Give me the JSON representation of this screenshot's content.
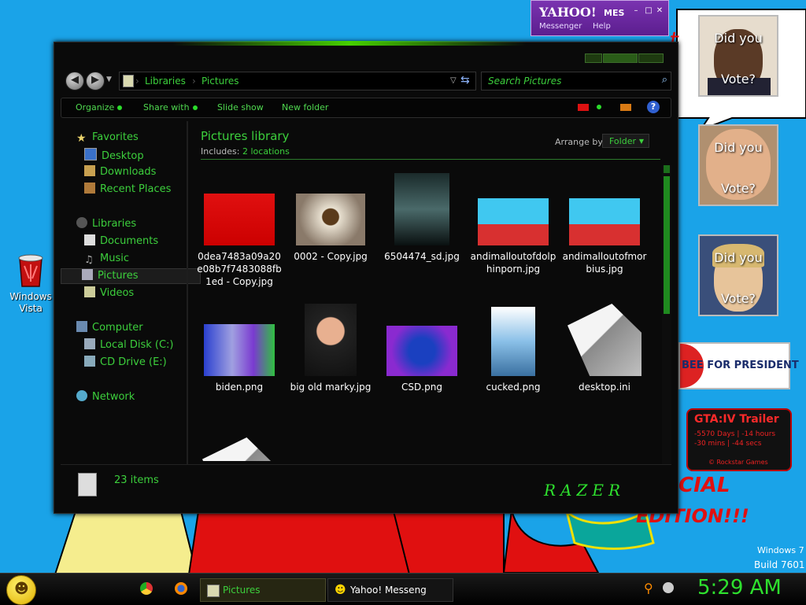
{
  "desktop": {
    "recycle_label": "Windows Vista",
    "watermark_line1": "Windows 7",
    "watermark_line2": "Build 7601",
    "bg_text1": "CIAL",
    "bg_text2": "EDITION!!!",
    "huckabee_text": "BEE FOR PRESIDENT",
    "vote_line1": "Did you",
    "vote_line2": "Vote?"
  },
  "yahoo": {
    "logo": "YAHOO!",
    "title_rest": "MES",
    "menu_messenger": "Messenger",
    "menu_help": "Help"
  },
  "gta": {
    "title": "GTA:IV Trailer",
    "line1": "-5570 Days | -14 hours",
    "line2": "-30 mins | -44 secs",
    "footer": "© Rockstar Games"
  },
  "window": {
    "breadcrumb": [
      "Libraries",
      "Pictures"
    ],
    "search_placeholder": "Search Pictures",
    "toolbar": {
      "organize": "Organize",
      "share_with": "Share with",
      "slide_show": "Slide show",
      "new_folder": "New folder"
    },
    "sidebar": {
      "favorites": "Favorites",
      "desktop": "Desktop",
      "downloads": "Downloads",
      "recent_places": "Recent Places",
      "libraries": "Libraries",
      "documents": "Documents",
      "music": "Music",
      "pictures": "Pictures",
      "videos": "Videos",
      "computer": "Computer",
      "local_disk": "Local Disk (C:)",
      "cd_drive": "CD Drive (E:)",
      "network": "Network"
    },
    "library": {
      "title": "Pictures library",
      "includes_label": "Includes:",
      "includes_link": "2 locations",
      "arrange_label": "Arrange by:",
      "arrange_value": "Folder"
    },
    "files": [
      {
        "name": "0dea7483a09a20e08b7f7483088fb1ed - Copy.jpg",
        "kind": "img-red"
      },
      {
        "name": "0002 - Copy.jpg",
        "kind": "img-toilet"
      },
      {
        "name": "6504474_sd.jpg",
        "kind": "img-poster"
      },
      {
        "name": "andimalloutofdolphinporn.jpg",
        "kind": "img-comic"
      },
      {
        "name": "andimalloutofmorbius.jpg",
        "kind": "img-comic"
      },
      {
        "name": "biden.png",
        "kind": "img-biden"
      },
      {
        "name": "big old marky.jpg",
        "kind": "img-marky"
      },
      {
        "name": "CSD.png",
        "kind": "img-csd"
      },
      {
        "name": "cucked.png",
        "kind": "img-cucked"
      },
      {
        "name": "desktop.ini",
        "kind": "ini"
      },
      {
        "name": "",
        "kind": "ini"
      },
      {
        "name": "",
        "kind": "img-dark"
      },
      {
        "name": "",
        "kind": "img-skin"
      },
      {
        "name": "",
        "kind": "img-pyramid"
      },
      {
        "name": "",
        "kind": "img-map"
      }
    ],
    "status_count": "23 items",
    "brand": "RAZER"
  },
  "taskbar": {
    "pictures_label": "Pictures",
    "yahoo_label": "Yahoo! Messeng",
    "clock": "5:29 AM"
  },
  "colors": {
    "accent_green": "#3ccf3c",
    "desktop_blue": "#1aa3e8",
    "window_bg": "#0a0a0a"
  }
}
